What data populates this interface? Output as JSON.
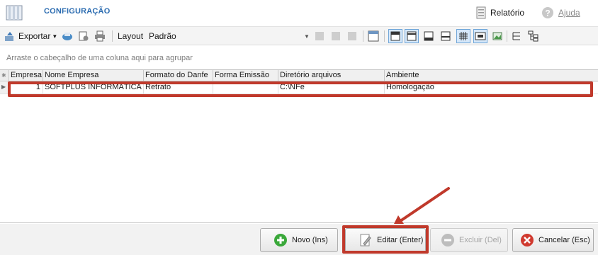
{
  "app": {
    "title": "CONFIGURAÇÃO",
    "icon": "window-config-icon"
  },
  "header": {
    "relatorio_label": "Relatório",
    "ajuda_label": "Ajuda"
  },
  "toolbar": {
    "export_label": "Exportar",
    "layout_label": "Layout",
    "padrao_label": "Padrão"
  },
  "grid": {
    "group_hint": "Arraste o cabeçalho de uma coluna aqui para agrupar",
    "columns": [
      "Empresa",
      "Nome Empresa",
      "Formato do Danfe",
      "Forma Emissão",
      "Diretório arquivos",
      "Ambiente"
    ],
    "rows": [
      {
        "empresa": "1",
        "nome": "SOFTPLUS INFORMÁTICA",
        "formato": "Retrato",
        "forma": "",
        "diretorio": "C:\\NFe",
        "ambiente": "Homologação"
      }
    ]
  },
  "footer": {
    "novo_label": "Novo (Ins)",
    "editar_label": "Editar (Enter)",
    "excluir_label": "Excluir (Del)",
    "cancelar_label": "Cancelar (Esc)"
  },
  "colors": {
    "accent": "#2a6bb0",
    "highlight": "#c0392b"
  }
}
